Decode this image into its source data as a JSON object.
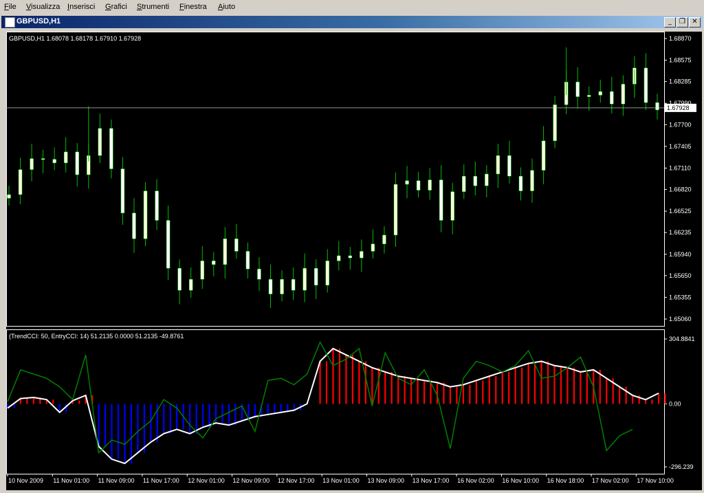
{
  "menu": [
    {
      "label": "File",
      "ul": "F",
      "rest": "ile"
    },
    {
      "label": "Visualizza",
      "ul": "V",
      "rest": "isualizza"
    },
    {
      "label": "Inserisci",
      "ul": "I",
      "rest": "nserisci"
    },
    {
      "label": "Grafici",
      "ul": "G",
      "rest": "rafici"
    },
    {
      "label": "Strumenti",
      "ul": "S",
      "rest": "trumenti"
    },
    {
      "label": "Finestra",
      "ul": "F",
      "rest": "inestra"
    },
    {
      "label": "Aiuto",
      "ul": "A",
      "rest": "iuto"
    }
  ],
  "window": {
    "title": "GBPUSD,H1",
    "buttons": {
      "minimize": "_",
      "restore": "❐",
      "close": "✕"
    }
  },
  "colors": {
    "background": "#000000",
    "bull_candle": "#ffffe0",
    "bear_candle": "#ffffff",
    "wick": "#00c000",
    "hist_positive": "#ff0000",
    "hist_negative": "#0000ff",
    "trend_cci": "#ffffff",
    "entry_cci": "#008000",
    "grid": "#ffffff",
    "bid_line": "#c0c0c0"
  },
  "chart_data": [
    {
      "type": "candlestick",
      "header": "GBPUSD,H1  1.68078 1.68178 1.67910 1.67928",
      "symbol": "GBPUSD,H1",
      "ohlc_last": [
        1.68078,
        1.68178,
        1.6791,
        1.67928
      ],
      "current_price": "1.67928",
      "y_ticks": [
        "1.68870",
        "1.68575",
        "1.68285",
        "1.67990",
        "1.67700",
        "1.67405",
        "1.67110",
        "1.66820",
        "1.66525",
        "1.66235",
        "1.65940",
        "1.65650",
        "1.65355",
        "1.65060"
      ],
      "ylim": [
        1.6506,
        1.6887
      ],
      "close_path": [
        1.6675,
        1.6709,
        1.6724,
        1.6723,
        1.6718,
        1.6733,
        1.6702,
        1.6728,
        1.6765,
        1.671,
        1.665,
        1.6615,
        1.668,
        1.664,
        1.6575,
        1.6545,
        1.656,
        1.6585,
        1.658,
        1.6615,
        1.6598,
        1.6574,
        1.656,
        1.654,
        1.656,
        1.6545,
        1.6575,
        1.6552,
        1.6585,
        1.6592,
        1.6589,
        1.6598,
        1.6608,
        1.662,
        1.6689,
        1.6694,
        1.6681,
        1.6695,
        1.664,
        1.6679,
        1.67,
        1.6687,
        1.6703,
        1.6728,
        1.67,
        1.668,
        1.6708,
        1.6748,
        1.6797,
        1.6828,
        1.6808,
        1.681,
        1.6815,
        1.6798,
        1.6825,
        1.6847,
        1.68,
        1.679
      ],
      "highlights": [
        1.6795,
        1.6875,
        1.6845
      ]
    },
    {
      "type": "bar+line",
      "header": "(TrendCCI: 50, EntryCCI: 14)  51.2135 0.0000  51.2135 -49.8761",
      "series": [
        {
          "name": "TrendCCI",
          "values": [
            -20,
            25,
            30,
            20,
            -40,
            15,
            40,
            -200,
            -260,
            -280,
            -230,
            -180,
            -140,
            -120,
            -140,
            -110,
            -90,
            -100,
            -80,
            -60,
            -50,
            -40,
            -30,
            0,
            200,
            260,
            230,
            200,
            170,
            150,
            130,
            120,
            110,
            100,
            80,
            90,
            110,
            130,
            150,
            170,
            190,
            200,
            180,
            170,
            150,
            160,
            120,
            80,
            40,
            20,
            50
          ]
        },
        {
          "name": "EntryCCI",
          "values": [
            10,
            160,
            140,
            120,
            80,
            20,
            230,
            -230,
            -170,
            -190,
            -130,
            -80,
            20,
            -20,
            -100,
            -160,
            -70,
            -40,
            -10,
            -130,
            110,
            120,
            90,
            140,
            290,
            180,
            210,
            260,
            -10,
            240,
            120,
            90,
            160,
            40,
            -210,
            120,
            200,
            180,
            150,
            180,
            250,
            120,
            130,
            170,
            220,
            80,
            -220,
            -150,
            -120
          ]
        }
      ],
      "y_ticks": [
        "304.8841",
        "0.00",
        "-296.239"
      ],
      "ylim": [
        -296.239,
        304.8841
      ],
      "x_ticks": [
        "10 Nov 2009",
        "11 Nov 01:00",
        "11 Nov 09:00",
        "11 Nov 17:00",
        "12 Nov 01:00",
        "12 Nov 09:00",
        "12 Nov 17:00",
        "13 Nov 01:00",
        "13 Nov 09:00",
        "13 Nov 17:00",
        "16 Nov 02:00",
        "16 Nov 10:00",
        "16 Nov 18:00",
        "17 Nov 02:00",
        "17 Nov 10:00"
      ]
    }
  ]
}
